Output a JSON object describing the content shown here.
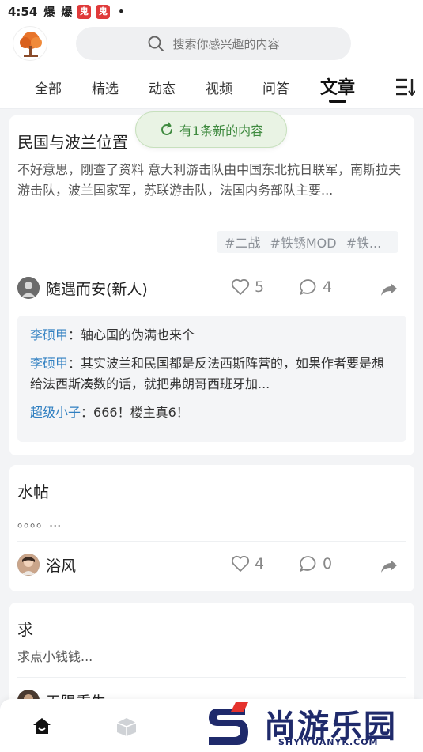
{
  "status_bar": {
    "time": "4:54",
    "icons": [
      "爆",
      "爆"
    ],
    "badges": [
      "鬼",
      "鬼"
    ],
    "dot": "•"
  },
  "search": {
    "placeholder": "搜索你感兴趣的内容"
  },
  "tabs": [
    "全部",
    "精选",
    "动态",
    "视频",
    "问答",
    "文章"
  ],
  "active_tab": "文章",
  "toast": {
    "text": "有1条新的内容"
  },
  "posts": [
    {
      "title": "民国与波兰位置",
      "excerpt": "不好意思，刚查了资料 意大利游击队由中国东北抗日联军，南斯拉夫游击队，波兰国家军，苏联游击队，法国内务部队主要...",
      "tags": [
        "#二战",
        "#铁锈MOD",
        "#铁..."
      ],
      "author": "随遇而安(新人)",
      "likes": "5",
      "comments": "4",
      "comment_previews": [
        {
          "user": "李硕甲",
          "sep": "：",
          "text": "轴心国的伪满也来个"
        },
        {
          "user": "李硕甲",
          "sep": "：",
          "text": "其实波兰和民国都是反法西斯阵营的，如果作者要是想给法西斯凑数的话，就把弗朗哥西班牙加..."
        },
        {
          "user": "超级小子",
          "sep": "：",
          "text": "666！楼主真6！"
        }
      ]
    },
    {
      "title": "水帖",
      "excerpt": "。。。。...",
      "author": "浴风",
      "likes": "4",
      "comments": "0"
    },
    {
      "title": "求",
      "excerpt": "求点小钱钱...",
      "author": "无限重生"
    }
  ],
  "watermark": {
    "brand_cn": "尚游乐园",
    "brand_en": "SHYIYUANYK.COM"
  },
  "colors": {
    "accent_blue": "#2f7fc1",
    "toast_green": "#3f8a3f",
    "brand_navy": "#1f2a6b"
  }
}
